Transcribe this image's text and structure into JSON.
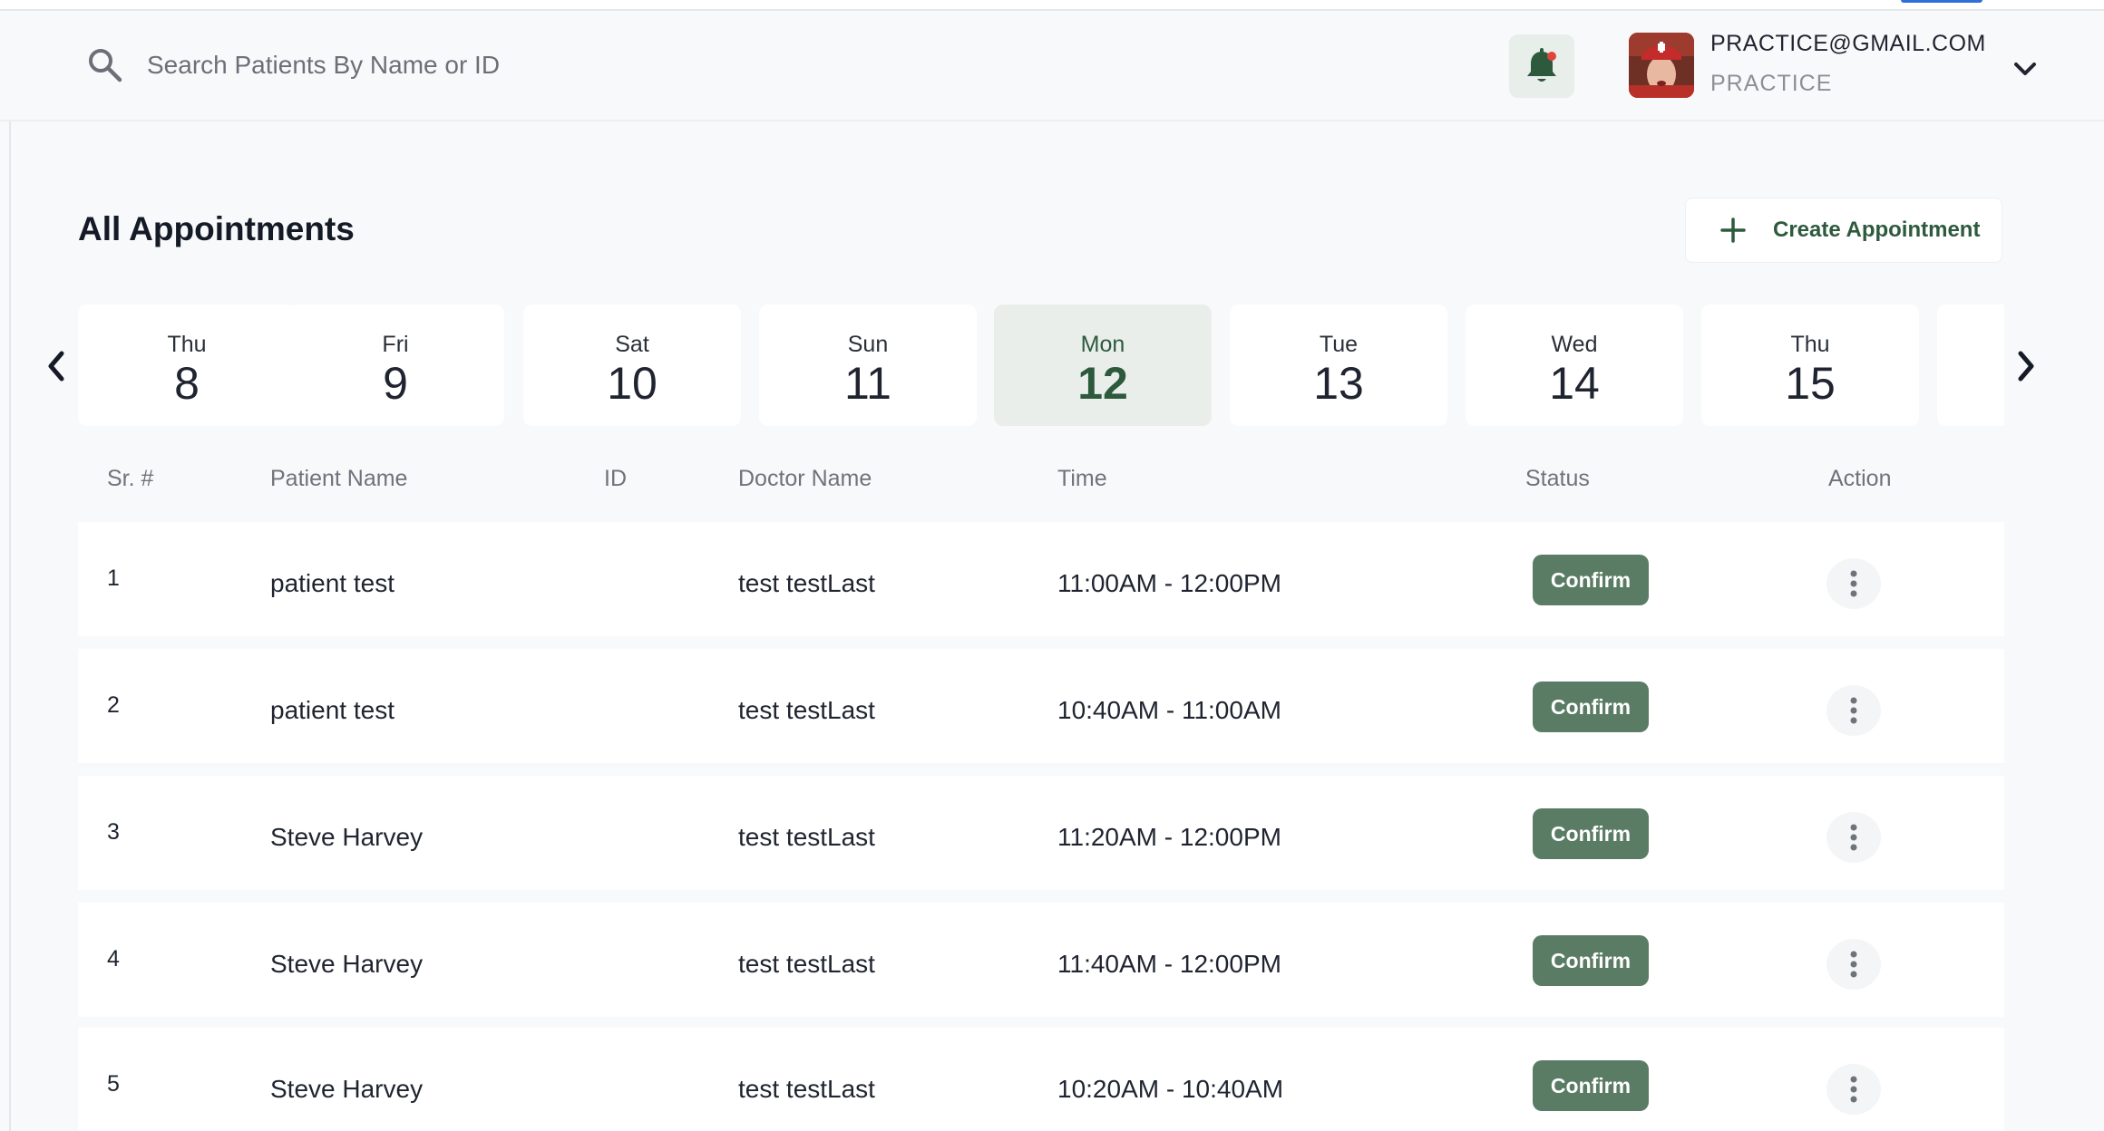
{
  "header": {
    "search_placeholder": "Search Patients By Name or ID",
    "user_email": "PRACTICE@GMAIL.COM",
    "user_role": "PRACTICE"
  },
  "page": {
    "title": "All Appointments",
    "create_label": "Create Appointment"
  },
  "dates": [
    {
      "dow": "Thu",
      "dom": "8"
    },
    {
      "dow": "Fri",
      "dom": "9"
    },
    {
      "dow": "Sat",
      "dom": "10"
    },
    {
      "dow": "Sun",
      "dom": "11"
    },
    {
      "dow": "Mon",
      "dom": "12",
      "selected": true
    },
    {
      "dow": "Tue",
      "dom": "13"
    },
    {
      "dow": "Wed",
      "dom": "14"
    },
    {
      "dow": "Thu",
      "dom": "15"
    }
  ],
  "table": {
    "columns": [
      "Sr. #",
      "Patient Name",
      "ID",
      "Doctor Name",
      "Time",
      "Status",
      "Action"
    ],
    "rows": [
      {
        "sr": "1",
        "patient": "patient test",
        "id": "",
        "doctor": "test testLast",
        "time": "11:00AM - 12:00PM",
        "status": "Confirm"
      },
      {
        "sr": "2",
        "patient": "patient test",
        "id": "",
        "doctor": "test testLast",
        "time": "10:40AM - 11:00AM",
        "status": "Confirm"
      },
      {
        "sr": "3",
        "patient": "Steve Harvey",
        "id": "",
        "doctor": "test testLast",
        "time": "11:20AM - 12:00PM",
        "status": "Confirm"
      },
      {
        "sr": "4",
        "patient": "Steve Harvey",
        "id": "",
        "doctor": "test testLast",
        "time": "11:40AM - 12:00PM",
        "status": "Confirm"
      },
      {
        "sr": "5",
        "patient": "Steve Harvey",
        "id": "",
        "doctor": "test testLast",
        "time": "10:20AM - 10:40AM",
        "status": "Confirm"
      }
    ]
  },
  "colors": {
    "brand_green": "#2d5a3d",
    "status_green": "#5a7c64",
    "selected_date_bg": "#e9eeeb",
    "notification_dot": "#e0453a"
  },
  "icons": {
    "search": "search-icon",
    "notifications": "bell-icon",
    "user_menu": "chevron-down-icon",
    "create": "plus-icon",
    "prev": "chevron-left-icon",
    "next": "chevron-right-icon",
    "row_action": "more-vertical-icon"
  }
}
